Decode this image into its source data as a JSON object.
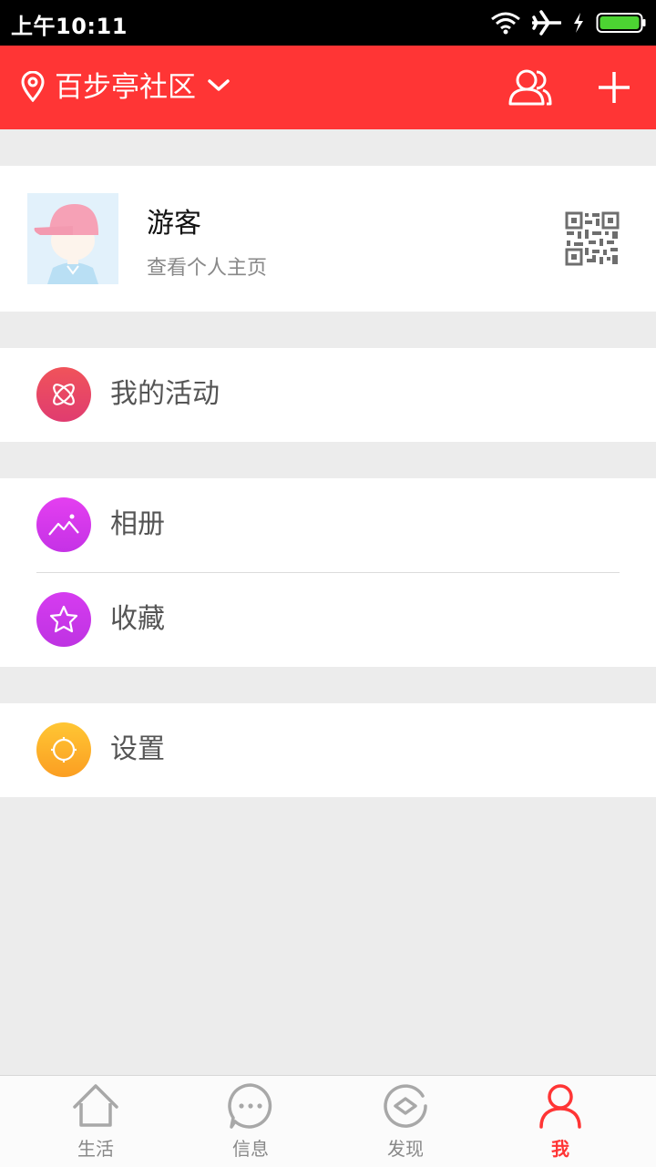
{
  "status_bar": {
    "time": "上午10:11",
    "icons": [
      "wifi-icon",
      "airplane-icon",
      "charging-icon",
      "battery-icon"
    ],
    "battery_color": "#4cd432"
  },
  "header": {
    "community_name": "百步亭社区",
    "background": "#ff3535",
    "icons": [
      "location-pin-icon",
      "chevron-down-icon",
      "members-icon",
      "add-icon"
    ]
  },
  "profile": {
    "name": "游客",
    "link_text": "查看个人主页",
    "icons": [
      "avatar",
      "qr-code-icon"
    ]
  },
  "menu": [
    {
      "label": "我的活动",
      "icon": "activity-icon",
      "color": "#e8465f"
    },
    {
      "label": "相册",
      "icon": "album-icon",
      "color": "#d838f0"
    },
    {
      "label": "收藏",
      "icon": "star-icon",
      "color": "#c936e8"
    },
    {
      "label": "设置",
      "icon": "settings-icon",
      "color": "#fdb22c"
    }
  ],
  "tabs": [
    {
      "label": "生活",
      "icon": "home-icon",
      "active": false
    },
    {
      "label": "信息",
      "icon": "message-icon",
      "active": false
    },
    {
      "label": "发现",
      "icon": "discover-icon",
      "active": false
    },
    {
      "label": "我",
      "icon": "person-icon",
      "active": true
    }
  ],
  "accent_color": "#ff3535"
}
